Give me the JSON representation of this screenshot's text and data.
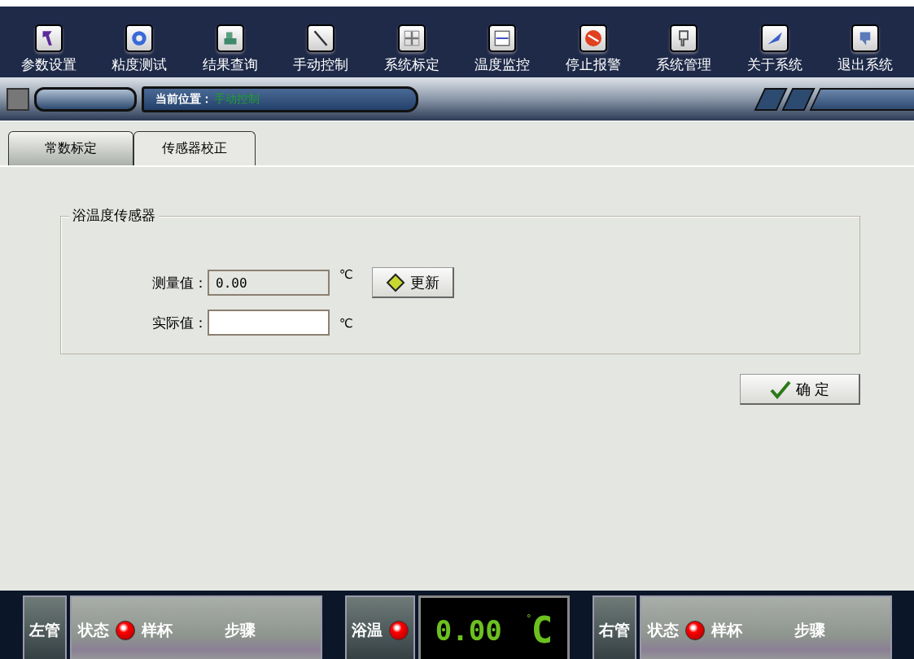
{
  "toolbar": {
    "items": [
      {
        "label": "参数设置"
      },
      {
        "label": "粘度测试"
      },
      {
        "label": "结果查询"
      },
      {
        "label": "手动控制"
      },
      {
        "label": "系统标定"
      },
      {
        "label": "温度监控"
      },
      {
        "label": "停止报警"
      },
      {
        "label": "系统管理"
      },
      {
        "label": "关于系统"
      },
      {
        "label": "退出系统"
      }
    ]
  },
  "breadcrumb": {
    "label": "当前位置：",
    "value": "手动控制"
  },
  "tabs": [
    {
      "label": "常数标定",
      "selected": false
    },
    {
      "label": "传感器校正",
      "selected": true
    }
  ],
  "group": {
    "title": "浴温度传感器",
    "measured": {
      "label": "测量值：",
      "value": "0.00",
      "unit": "℃",
      "disabled": true
    },
    "actual": {
      "label": "实际值：",
      "unit": "℃"
    },
    "refresh_button": "更新"
  },
  "ok_button": "确 定",
  "status_bar": {
    "left": {
      "title": "左管",
      "state": "状态",
      "cup": "样杯",
      "step": "步骤"
    },
    "bath": {
      "title": "浴温",
      "reading": "0.00",
      "degree": "°",
      "unit": "C"
    },
    "right": {
      "title": "右管",
      "state": "状态",
      "cup": "样杯",
      "step": "步骤"
    }
  }
}
